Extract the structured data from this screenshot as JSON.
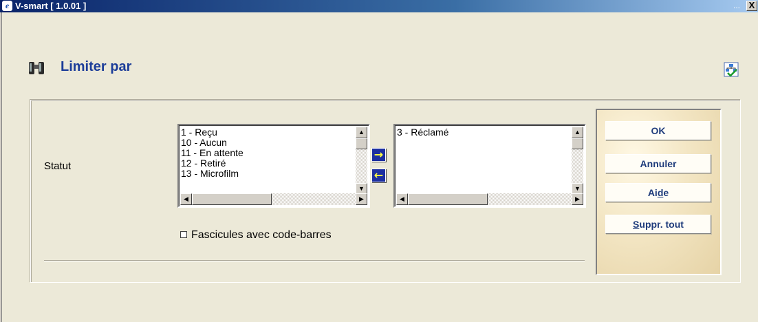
{
  "window": {
    "title": "V-smart [ 1.0.01 ]",
    "app_icon_glyph": "e",
    "dots": "...",
    "close_glyph": "X"
  },
  "page": {
    "heading": "Limiter par",
    "heading_icon": "binoculars-icon",
    "top_right_icon": "tree-check-icon"
  },
  "form": {
    "statut_label": "Statut",
    "available_list": [
      "1 - Reçu",
      "10 - Aucun",
      "11 - En attente",
      "12 - Retiré",
      "13 - Microfilm"
    ],
    "selected_list": [
      "3 - Réclamé"
    ],
    "move_right_glyph": "→",
    "move_left_glyph": "←",
    "checkbox_label": "Fascicules avec code-barres",
    "checkbox_checked": false
  },
  "buttons": {
    "ok": "OK",
    "cancel": "Annuler",
    "help_pre": "Ai",
    "help_u": "d",
    "help_post": "e",
    "clear_u": "S",
    "clear_post": "uppr. tout"
  },
  "colors": {
    "title_bar": "#0a246a",
    "heading": "#1c3d99",
    "arrow_button": "#1c2fa0",
    "command_text": "#1f3c7c"
  }
}
